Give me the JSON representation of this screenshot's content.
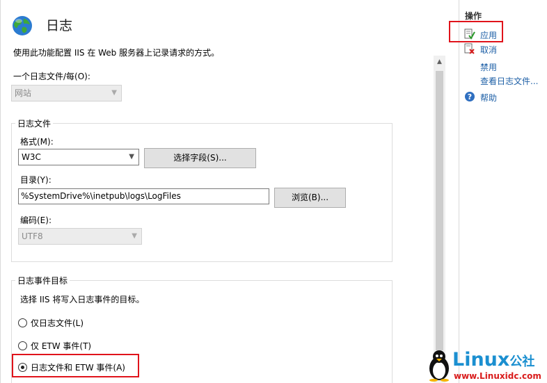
{
  "page": {
    "title": "日志",
    "description": "使用此功能配置 IIS 在 Web 服务器上记录请求的方式。",
    "per_label": "一个日志文件/每(O):",
    "per_value": "网站"
  },
  "log_file_group": {
    "title": "日志文件",
    "format_label": "格式(M):",
    "format_value": "W3C",
    "select_fields_button": "选择字段(S)...",
    "directory_label": "目录(Y):",
    "directory_value": "%SystemDrive%\\inetpub\\logs\\LogFiles",
    "browse_button": "浏览(B)...",
    "encoding_label": "编码(E):",
    "encoding_value": "UTF8"
  },
  "event_group": {
    "title": "日志事件目标",
    "description": "选择 IIS 将写入日志事件的目标。",
    "options": [
      {
        "label": "仅日志文件(L)",
        "checked": false
      },
      {
        "label": "仅 ETW 事件(T)",
        "checked": false
      },
      {
        "label": "日志文件和 ETW 事件(A)",
        "checked": true
      }
    ]
  },
  "actions": {
    "header": "操作",
    "apply": "应用",
    "cancel": "取消",
    "disable": "禁用",
    "view_log_files": "查看日志文件...",
    "help": "帮助"
  },
  "watermark": {
    "logo": "Linux",
    "logo_cn": "公社",
    "url": "www.Linuxidc.com"
  },
  "colors": {
    "highlight_box": "#e0131b",
    "link": "#1d5fa6"
  }
}
